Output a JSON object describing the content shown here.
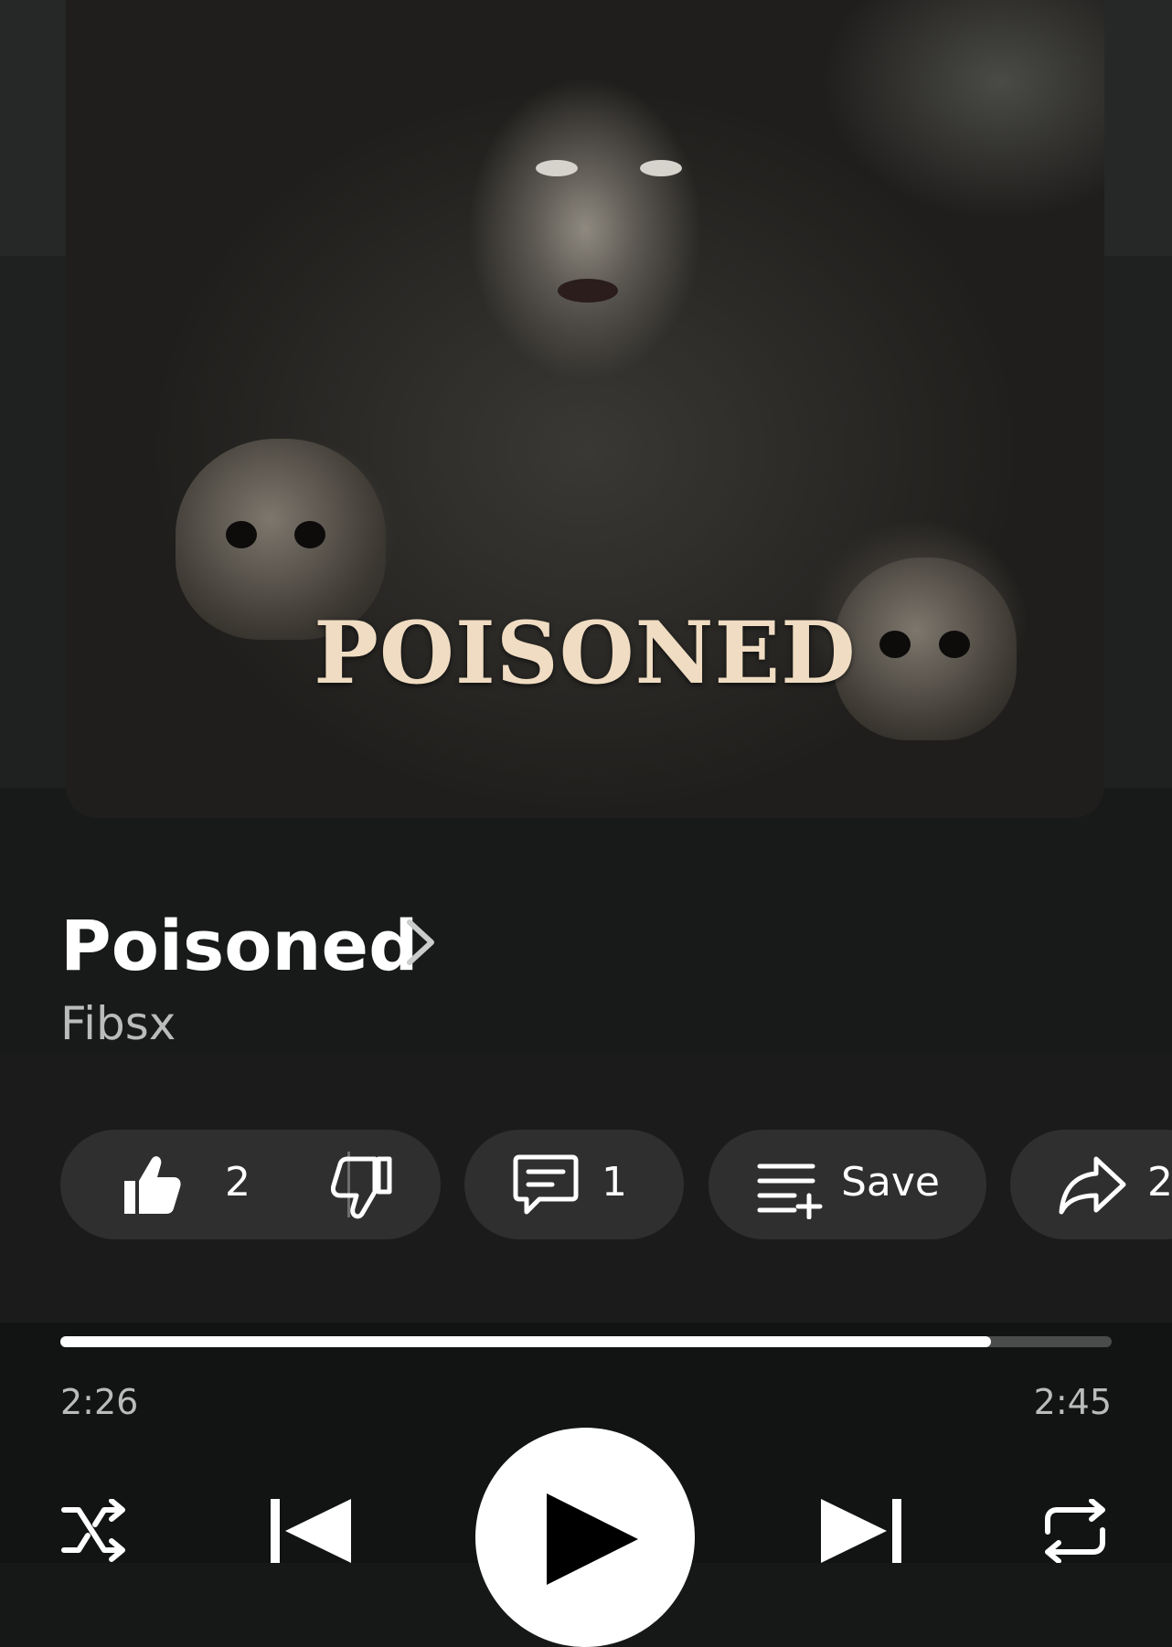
{
  "album_art": {
    "title_text": "POISONED"
  },
  "song": {
    "title": "Poisoned",
    "artist": "Fibsx"
  },
  "actions": {
    "like_count": "2",
    "comment_count": "1",
    "save_label": "Save",
    "share_count": "2"
  },
  "playback": {
    "elapsed": "2:26",
    "duration": "2:45",
    "progress_fraction": 0.885
  },
  "icons": [
    "chevron-right-icon",
    "thumbs-up-icon",
    "thumbs-down-icon",
    "comment-icon",
    "playlist-add-icon",
    "share-icon",
    "shuffle-icon",
    "previous-icon",
    "play-icon",
    "next-icon",
    "repeat-icon"
  ],
  "colors": {
    "background": "#151817",
    "chip": "#2f2f2f",
    "progress_fill": "#ffffff",
    "progress_track": "#4a4c4b",
    "art_title": "#efdcc2"
  }
}
